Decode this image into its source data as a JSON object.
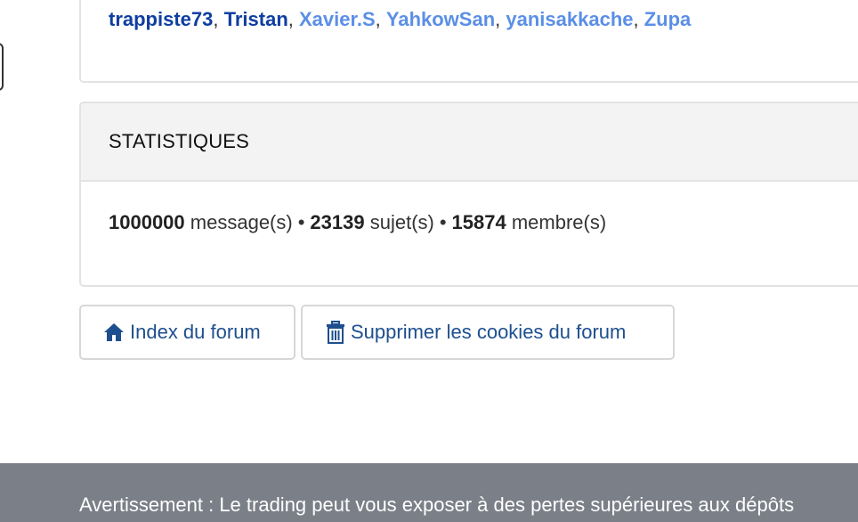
{
  "online_users": {
    "visible": [
      {
        "name": "trappiste73",
        "style": "dark"
      },
      {
        "name": "Tristan",
        "style": "dark"
      },
      {
        "name": "Xavier.S",
        "style": "light"
      },
      {
        "name": "YahkowSan",
        "style": "light"
      },
      {
        "name": "yanisakkache",
        "style": "light"
      },
      {
        "name": "Zupa",
        "style": "light"
      }
    ],
    "separator": ", "
  },
  "statistics": {
    "title": "STATISTIQUES",
    "messages_count": "1000000",
    "messages_label": "message(s)",
    "topics_count": "23139",
    "topics_label": "sujet(s)",
    "members_count": "15874",
    "members_label": "membre(s)",
    "bullet": "•"
  },
  "buttons": {
    "index_label": "Index du forum",
    "cookies_label": "Supprimer les cookies du forum"
  },
  "footer": {
    "warning": "Avertissement : Le trading peut vous exposer à des pertes supérieures aux dépôts"
  },
  "colors": {
    "link_dark": "#0e3ea0",
    "link_light": "#5b8fe6",
    "button_text": "#1d4f8f",
    "footer_bg": "#7b7f87"
  },
  "icons": {
    "index": "home-icon",
    "cookies": "trash-icon"
  }
}
